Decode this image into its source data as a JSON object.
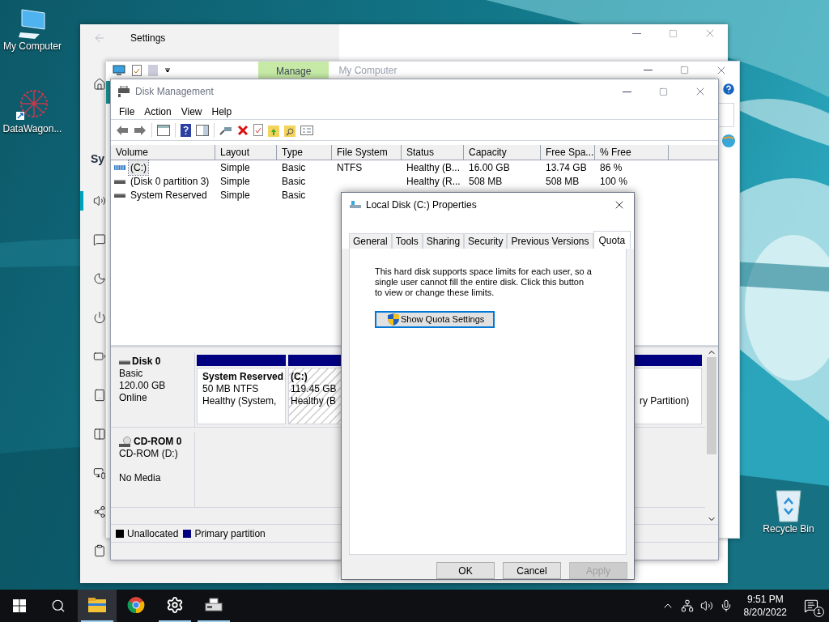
{
  "desktop": {
    "icons": [
      {
        "label": "My Computer"
      },
      {
        "label": "DataWagon..."
      },
      {
        "label": "Recycle Bin"
      }
    ]
  },
  "settings_window": {
    "title": "Settings",
    "heading": "Sy",
    "nav": [
      {
        "selected": true
      },
      {
        "selected": false
      },
      {
        "selected": false
      },
      {
        "selected": false
      },
      {
        "selected": false
      },
      {
        "selected": false
      },
      {
        "selected": false
      },
      {
        "selected": false
      },
      {
        "selected": false
      },
      {
        "selected": false
      }
    ]
  },
  "computer_management": {
    "ribbon_tab": "Manage",
    "title": "My Computer"
  },
  "disk_management": {
    "title": "Disk Management",
    "menu": [
      "File",
      "Action",
      "View",
      "Help"
    ],
    "columns": [
      "Volume",
      "Layout",
      "Type",
      "File System",
      "Status",
      "Capacity",
      "Free Spa...",
      "% Free"
    ],
    "rows": [
      {
        "selected": true,
        "kind": "striped",
        "cells": [
          "(C:)",
          "Simple",
          "Basic",
          "NTFS",
          "Healthy (B...",
          "16.00 GB",
          "13.74 GB",
          "86 %"
        ]
      },
      {
        "selected": false,
        "kind": "plain",
        "cells": [
          "(Disk 0 partition 3)",
          "Simple",
          "Basic",
          "",
          "Healthy (R...",
          "508 MB",
          "508 MB",
          "100 %"
        ]
      },
      {
        "selected": false,
        "kind": "plain",
        "cells": [
          "System Reserved",
          "Simple",
          "Basic"
        ]
      }
    ],
    "disks": [
      {
        "kind": "disk",
        "name": "Disk 0",
        "type": "Basic",
        "size": "120.00 GB",
        "status": "Online",
        "partitions": [
          {
            "name": "System Reserved",
            "size": "50 MB NTFS",
            "status": "Healthy (System,",
            "hatched": false
          },
          {
            "name": "(C:)",
            "size": "119.45 GB",
            "status": "Healthy (B",
            "hatched": true
          },
          {
            "status": "ry Partition)",
            "hatched": false
          }
        ]
      },
      {
        "kind": "cdrom",
        "name": "CD-ROM 0",
        "type": "CD-ROM (D:)",
        "status": "No Media"
      }
    ],
    "legend": [
      {
        "label": "Unallocated",
        "color": "#000000"
      },
      {
        "label": "Primary partition",
        "color": "#000080"
      }
    ]
  },
  "dialog": {
    "title": "Local Disk (C:) Properties",
    "tabs": [
      {
        "label": "General",
        "selected": false
      },
      {
        "label": "Tools",
        "selected": false
      },
      {
        "label": "Sharing",
        "selected": false
      },
      {
        "label": "Security",
        "selected": false
      },
      {
        "label": "Previous Versions",
        "selected": false
      },
      {
        "label": "Quota",
        "selected": true
      }
    ],
    "description": "This hard disk supports space limits for each user, so a single user cannot fill the entire disk. Click this button to view or change these limits.",
    "action_button": "Show Quota Settings",
    "buttons": [
      {
        "label": "OK",
        "disabled": false
      },
      {
        "label": "Cancel",
        "disabled": false
      },
      {
        "label": "Apply",
        "disabled": true
      }
    ]
  },
  "taskbar": {
    "apps": [
      {
        "selected": true,
        "running": true
      },
      {
        "selected": false,
        "running": false
      },
      {
        "selected": false,
        "running": true
      },
      {
        "selected": false,
        "running": true
      }
    ],
    "time": "9:51 PM",
    "date": "8/20/2022",
    "notifications": "1"
  }
}
